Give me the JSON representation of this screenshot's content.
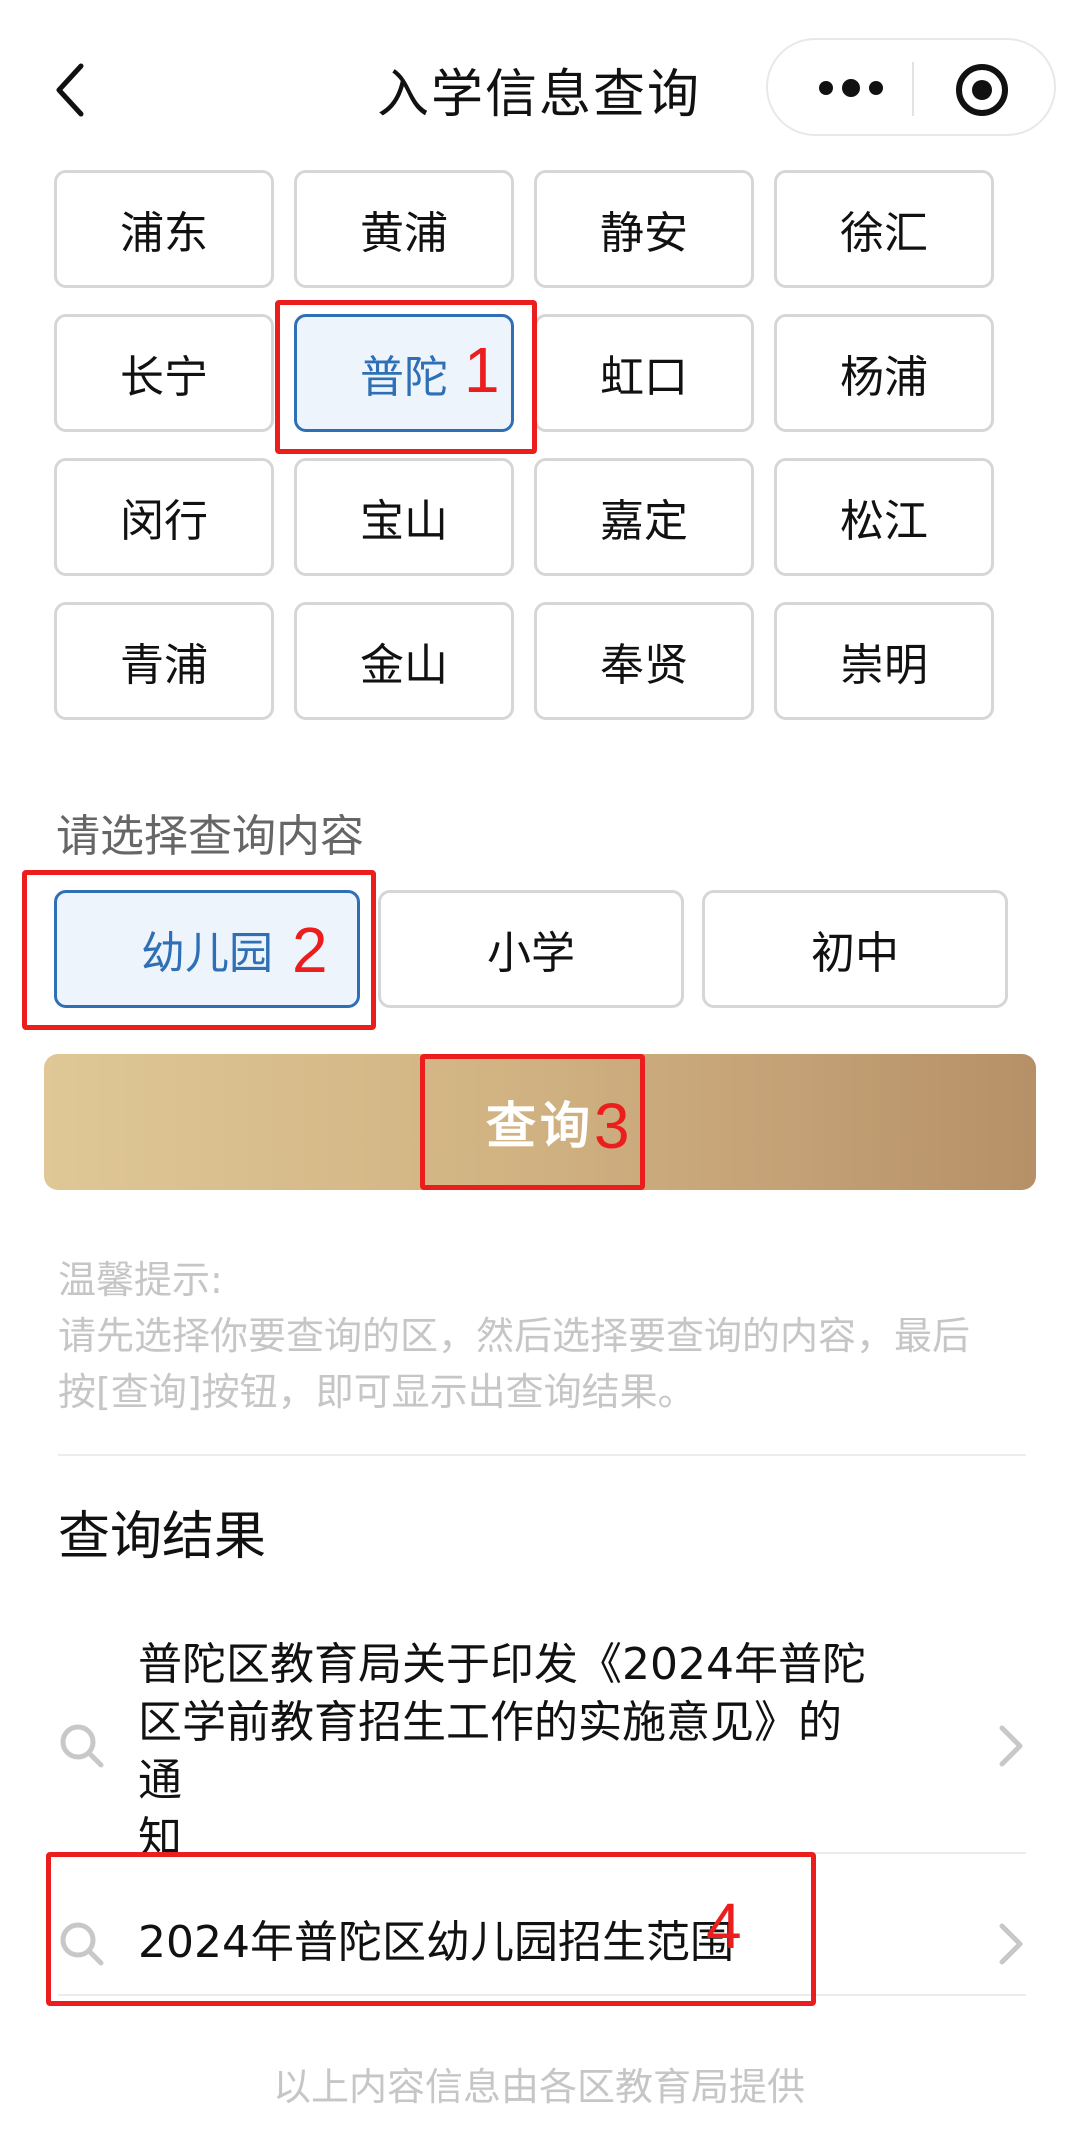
{
  "header": {
    "title": "入学信息查询"
  },
  "districts": [
    "浦东",
    "黄浦",
    "静安",
    "徐汇",
    "长宁",
    "普陀",
    "虹口",
    "杨浦",
    "闵行",
    "宝山",
    "嘉定",
    "松江",
    "青浦",
    "金山",
    "奉贤",
    "崇明"
  ],
  "selected_district": "普陀",
  "content_section": {
    "label": "请选择查询内容",
    "options": [
      "幼儿园",
      "小学",
      "初中"
    ],
    "selected": "幼儿园"
  },
  "query_button": "查询",
  "tip": {
    "title": "温馨提示:",
    "line1": "请先选择你要查询的区，然后选择要查询的内容，最后",
    "line2": "按[查询]按钮，即可显示出查询结果。"
  },
  "results": {
    "title": "查询结果",
    "items": [
      {
        "line1": "普陀区教育局关于印发《2024年普陀",
        "line2": "区学前教育招生工作的实施意见》的通",
        "line3": "知"
      },
      {
        "line1": "2024年普陀区幼儿园招生范围"
      }
    ]
  },
  "footer_note": "以上内容信息由各区教育局提供",
  "annotations": [
    "1",
    "2",
    "3",
    "4"
  ],
  "colors": {
    "accent_blue": "#2f6fb5",
    "annotation_red": "#ec1d1d",
    "gold_start": "#dfc796",
    "gold_end": "#b69067"
  }
}
